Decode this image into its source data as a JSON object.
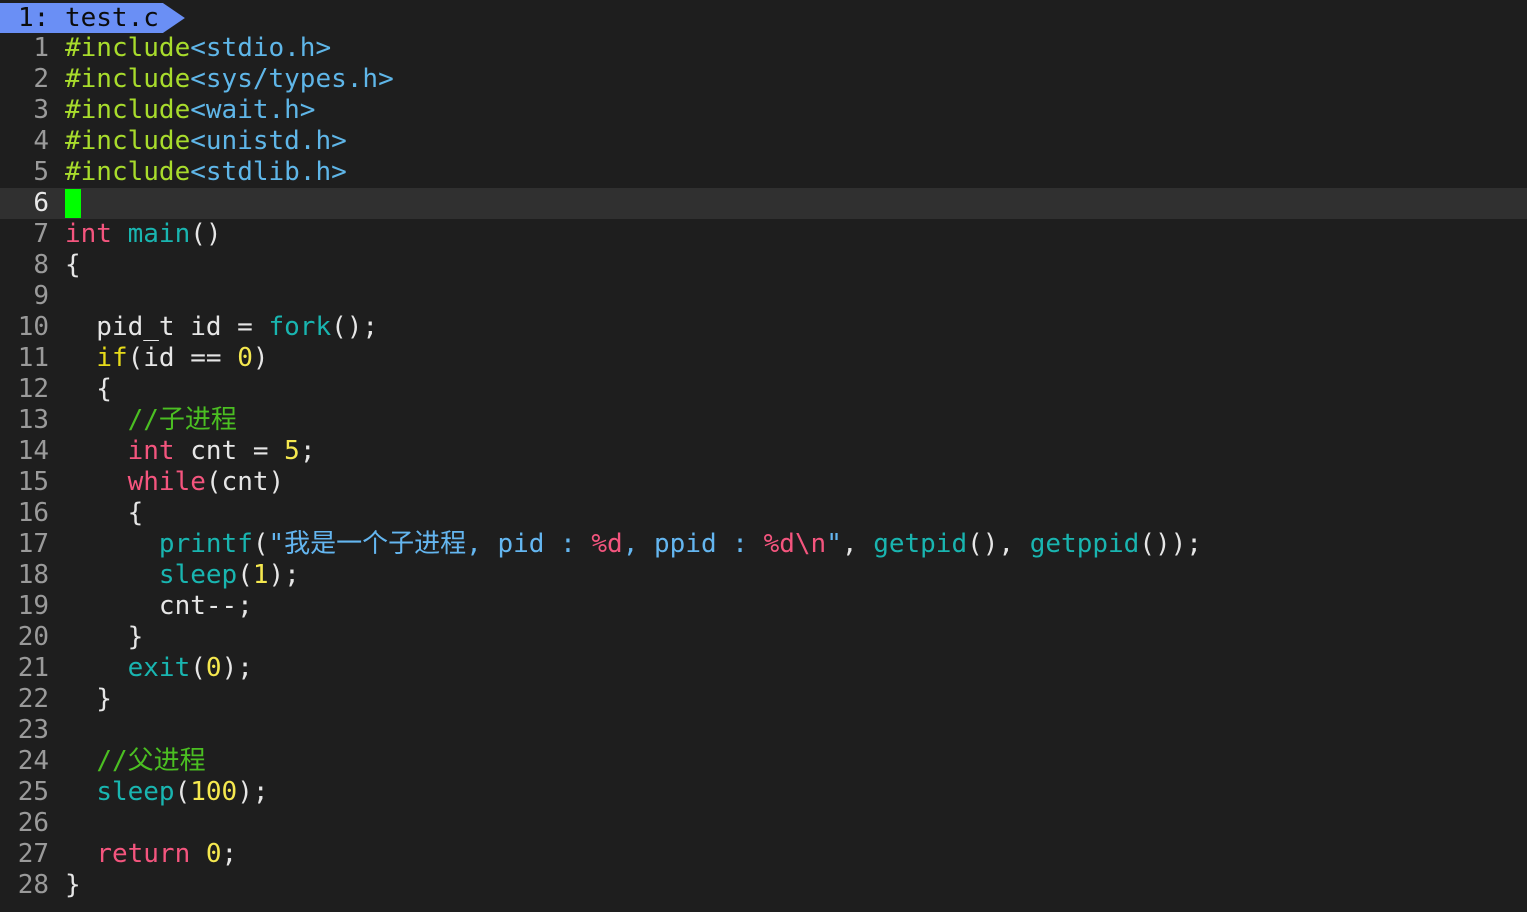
{
  "tab": {
    "label": "1: test.c"
  },
  "colors": {
    "background": "#1e1e1e",
    "current_line": "#303030",
    "cursor": "#00ff00",
    "tab": "#6a8ff5",
    "keyword": "#f4557e",
    "control": "#e6db1a",
    "preprocessor": "#a8dc2c",
    "include_path": "#5fb6e8",
    "function": "#19b5b0",
    "number": "#f5e84f",
    "comment": "#4bbf22",
    "string": "#64b6f0"
  },
  "editor": {
    "cursor_line": 6,
    "lines": [
      {
        "n": "1",
        "t": [
          [
            "pre",
            "#include"
          ],
          [
            "inc",
            "<stdio.h>"
          ]
        ]
      },
      {
        "n": "2",
        "t": [
          [
            "pre",
            "#include"
          ],
          [
            "inc",
            "<sys/types.h>"
          ]
        ]
      },
      {
        "n": "3",
        "t": [
          [
            "pre",
            "#include"
          ],
          [
            "inc",
            "<wait.h>"
          ]
        ]
      },
      {
        "n": "4",
        "t": [
          [
            "pre",
            "#include"
          ],
          [
            "inc",
            "<unistd.h>"
          ]
        ]
      },
      {
        "n": "5",
        "t": [
          [
            "pre",
            "#include"
          ],
          [
            "inc",
            "<stdlib.h>"
          ]
        ]
      },
      {
        "n": "6",
        "t": []
      },
      {
        "n": "7",
        "t": [
          [
            "kw",
            "int"
          ],
          [
            "",
            " "
          ],
          [
            "fn",
            "main"
          ],
          [
            "",
            "()"
          ]
        ]
      },
      {
        "n": "8",
        "t": [
          [
            "",
            "{"
          ]
        ]
      },
      {
        "n": "9",
        "t": []
      },
      {
        "n": "10",
        "t": [
          [
            "",
            "  pid_t id = "
          ],
          [
            "fn",
            "fork"
          ],
          [
            "",
            "();"
          ]
        ]
      },
      {
        "n": "11",
        "t": [
          [
            "",
            "  "
          ],
          [
            "ctl",
            "if"
          ],
          [
            "",
            "(id == "
          ],
          [
            "num",
            "0"
          ],
          [
            "",
            ")"
          ]
        ]
      },
      {
        "n": "12",
        "t": [
          [
            "",
            "  {"
          ]
        ]
      },
      {
        "n": "13",
        "t": [
          [
            "",
            "    "
          ],
          [
            "cmt",
            "//子进程"
          ]
        ]
      },
      {
        "n": "14",
        "t": [
          [
            "",
            "    "
          ],
          [
            "kw",
            "int"
          ],
          [
            "",
            " cnt = "
          ],
          [
            "num",
            "5"
          ],
          [
            "",
            ";"
          ]
        ]
      },
      {
        "n": "15",
        "t": [
          [
            "",
            "    "
          ],
          [
            "kw",
            "while"
          ],
          [
            "",
            "(cnt)"
          ]
        ]
      },
      {
        "n": "16",
        "t": [
          [
            "",
            "    {"
          ]
        ]
      },
      {
        "n": "17",
        "t": [
          [
            "",
            "      "
          ],
          [
            "fn",
            "printf"
          ],
          [
            "",
            "("
          ],
          [
            "str",
            "\"我是一个子进程, pid : "
          ],
          [
            "fmt",
            "%d"
          ],
          [
            "str",
            ", ppid : "
          ],
          [
            "fmt",
            "%d\\n"
          ],
          [
            "str",
            "\""
          ],
          [
            "",
            ", "
          ],
          [
            "fn",
            "getpid"
          ],
          [
            "",
            "(), "
          ],
          [
            "fn",
            "getppid"
          ],
          [
            "",
            "());"
          ]
        ]
      },
      {
        "n": "18",
        "t": [
          [
            "",
            "      "
          ],
          [
            "fn",
            "sleep"
          ],
          [
            "",
            "("
          ],
          [
            "num",
            "1"
          ],
          [
            "",
            ");"
          ]
        ]
      },
      {
        "n": "19",
        "t": [
          [
            "",
            "      cnt--;"
          ]
        ]
      },
      {
        "n": "20",
        "t": [
          [
            "",
            "    }"
          ]
        ]
      },
      {
        "n": "21",
        "t": [
          [
            "",
            "    "
          ],
          [
            "fn",
            "exit"
          ],
          [
            "",
            "("
          ],
          [
            "num",
            "0"
          ],
          [
            "",
            ");"
          ]
        ]
      },
      {
        "n": "22",
        "t": [
          [
            "",
            "  }"
          ]
        ]
      },
      {
        "n": "23",
        "t": []
      },
      {
        "n": "24",
        "t": [
          [
            "",
            "  "
          ],
          [
            "cmt",
            "//父进程"
          ]
        ]
      },
      {
        "n": "25",
        "t": [
          [
            "",
            "  "
          ],
          [
            "fn",
            "sleep"
          ],
          [
            "",
            "("
          ],
          [
            "num",
            "100"
          ],
          [
            "",
            ");"
          ]
        ]
      },
      {
        "n": "26",
        "t": []
      },
      {
        "n": "27",
        "t": [
          [
            "",
            "  "
          ],
          [
            "kw",
            "return"
          ],
          [
            "",
            " "
          ],
          [
            "num",
            "0"
          ],
          [
            "",
            ";"
          ]
        ]
      },
      {
        "n": "28",
        "t": [
          [
            "",
            "}"
          ]
        ]
      }
    ]
  }
}
